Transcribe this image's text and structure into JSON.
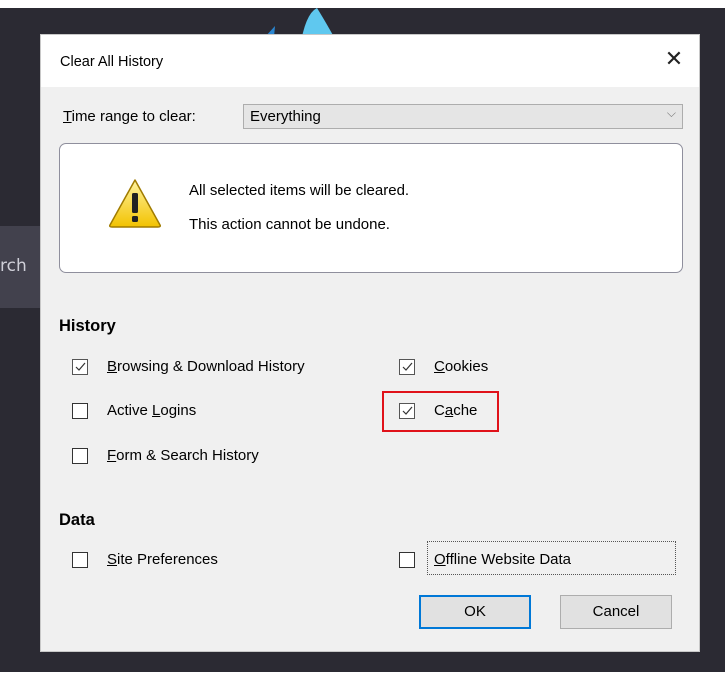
{
  "background": {
    "search_fragment": "rch"
  },
  "dialog": {
    "title": "Clear All History",
    "close_glyph": "✕",
    "time_range": {
      "label_prefix": "",
      "label_key": "T",
      "label_rest": "ime range to clear:",
      "selected": "Everything",
      "chevron": "⌵"
    },
    "warning": {
      "icon": "warning-icon",
      "line1": "All selected items will be cleared.",
      "line2": "This action cannot be undone."
    },
    "history": {
      "title": "History",
      "items": [
        {
          "key": "B",
          "rest": "rowsing & Download History",
          "checked": true
        },
        {
          "key": "C",
          "rest": "ookies",
          "checked": true
        },
        {
          "pre": "Active ",
          "key": "L",
          "rest": "ogins",
          "checked": false
        },
        {
          "pre": "C",
          "key": "a",
          "rest": "che",
          "checked": true
        },
        {
          "key": "F",
          "rest": "orm & Search History",
          "checked": false
        }
      ]
    },
    "data": {
      "title": "Data",
      "items": [
        {
          "key": "S",
          "rest": "ite Preferences",
          "checked": false
        },
        {
          "key": "O",
          "rest": "ffline Website Data",
          "checked": false
        }
      ]
    },
    "buttons": {
      "ok": "OK",
      "cancel": "Cancel"
    }
  },
  "colors": {
    "highlight": "#e0121a",
    "ok_border": "#0078d7",
    "dark_bg": "#2b2a33"
  }
}
